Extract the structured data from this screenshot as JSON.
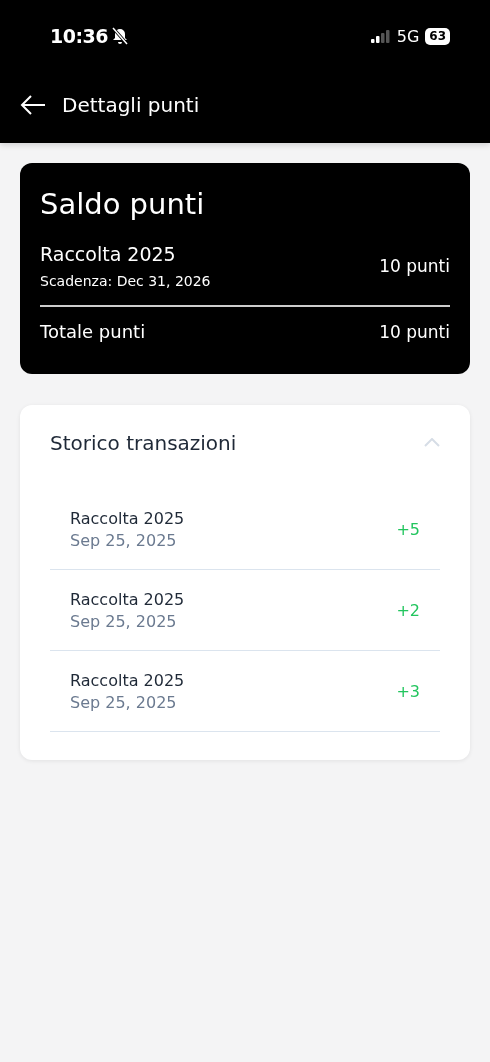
{
  "status_bar": {
    "time": "10:36",
    "network": "5G",
    "battery": "63"
  },
  "header": {
    "title": "Dettagli punti"
  },
  "balance": {
    "title": "Saldo punti",
    "entries": [
      {
        "name": "Raccolta 2025",
        "expiry": "Scadenza: Dec 31, 2026",
        "points": "10 punti"
      }
    ],
    "total": {
      "label": "Totale punti",
      "points": "10 punti"
    }
  },
  "history": {
    "title": "Storico transazioni",
    "expanded": true,
    "transactions": [
      {
        "name": "Raccolta 2025",
        "date": "Sep 25, 2025",
        "amount": "+5"
      },
      {
        "name": "Raccolta 2025",
        "date": "Sep 25, 2025",
        "amount": "+2"
      },
      {
        "name": "Raccolta 2025",
        "date": "Sep 25, 2025",
        "amount": "+3"
      }
    ]
  }
}
